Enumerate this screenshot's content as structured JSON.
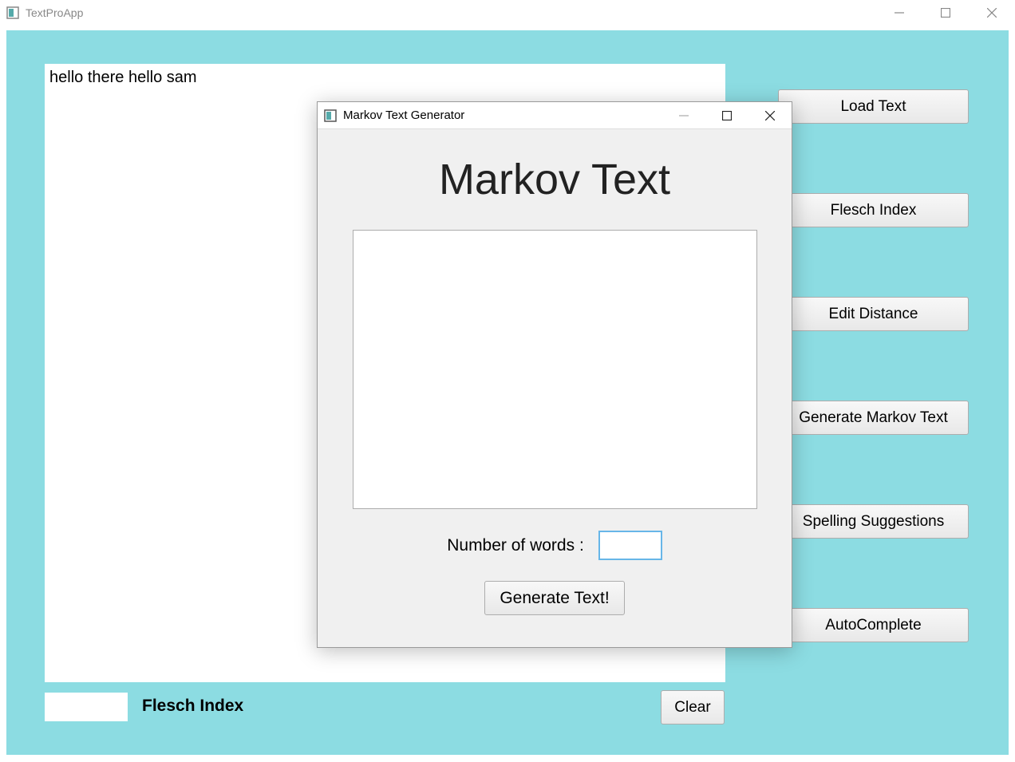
{
  "main_window": {
    "title": "TextProApp",
    "editor_value": "hello there hello sam",
    "flesch_output": "",
    "flesch_label": "Flesch Index",
    "clear_label": "Clear",
    "buttons": [
      "Load Text",
      "Flesch Index",
      "Edit Distance",
      "Generate Markov Text",
      "Spelling Suggestions",
      "AutoComplete"
    ]
  },
  "dialog": {
    "title": "Markov Text Generator",
    "heading": "Markov Text",
    "output_value": "",
    "num_words_label": "Number of words :",
    "num_words_value": "",
    "generate_label": "Generate Text!"
  },
  "colors": {
    "client_bg": "#8cdce2",
    "button_border": "#adadad",
    "input_focus_border": "#67b6e8"
  }
}
